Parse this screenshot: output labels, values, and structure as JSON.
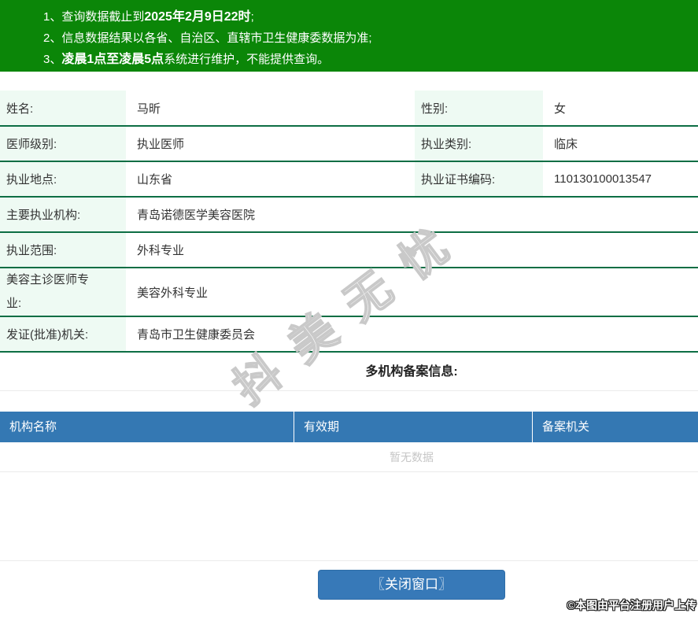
{
  "colors": {
    "banner_green": "#0b8608",
    "line_green": "#0d6e44",
    "label_bg": "#eefaf3",
    "header_blue": "#3478b3",
    "button_blue": "#3779b8"
  },
  "notices": [
    {
      "num": "1、",
      "pre": "查询数据截止到",
      "bold": "2025年2月9日22时",
      "post": ";"
    },
    {
      "num": "2、",
      "pre": "信息数据结果以各省、自治区、直辖市卫生健康委数据为准;",
      "bold": "",
      "post": ""
    },
    {
      "num": "3、",
      "pre": "",
      "bold": "凌晨1点至凌晨5点",
      "post": "系统进行维护，不能提供查询。"
    }
  ],
  "info": {
    "rows": [
      {
        "label": "姓名:",
        "value": "马昕",
        "label2": "性别:",
        "value2": "女"
      },
      {
        "label": "医师级别:",
        "value": "执业医师",
        "label2": "执业类别:",
        "value2": "临床"
      },
      {
        "label": "执业地点:",
        "value": "山东省",
        "label2": "执业证书编码:",
        "value2": "110130100013547"
      },
      {
        "label": "主要执业机构:",
        "value": "青岛诺德医学美容医院"
      },
      {
        "label": "执业范围:",
        "value": "外科专业"
      },
      {
        "label": "美容主诊医师专业:",
        "value": "美容外科专业"
      },
      {
        "label": "发证(批准)机关:",
        "value": "青岛市卫生健康委员会"
      }
    ]
  },
  "multi_org": {
    "heading": "多机构备案信息:",
    "columns": [
      "机构名称",
      "有效期",
      "备案机关"
    ],
    "empty_text": "暂无数据"
  },
  "footer": {
    "close_button": "〖关闭窗口〗"
  },
  "watermark": {
    "diagonal": "抖美无忧",
    "stamp": "©本图由平台注册用户上传"
  }
}
